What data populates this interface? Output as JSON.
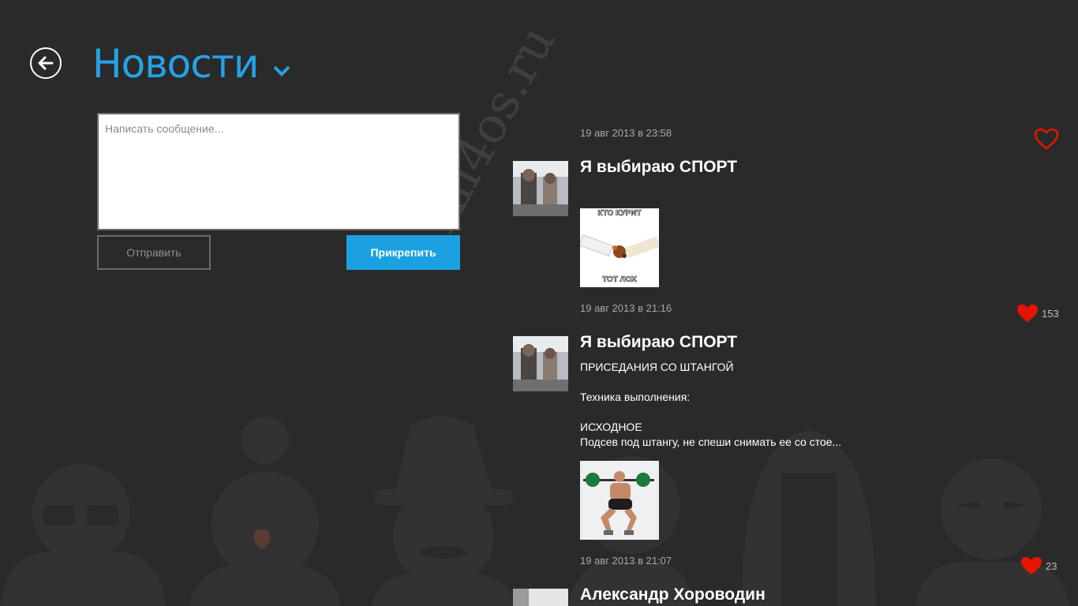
{
  "header": {
    "title": "Новости",
    "back_icon": "back-arrow-icon",
    "dropdown_icon": "chevron-down-icon"
  },
  "composer": {
    "placeholder": "Написать сообщение...",
    "value": "",
    "send_label": "Отправить",
    "attach_label": "Прикрепить"
  },
  "watermark": "All4os.ru",
  "colors": {
    "accent": "#1ba1e2",
    "title": "#27a1e5",
    "like": "#e51400",
    "background": "#2a2a2a"
  },
  "posts": [
    {
      "date": "19 авг 2013 в 23:58",
      "author": "Я выбираю СПОРТ",
      "text": "",
      "image_caption_top": "КТО КУРИТ",
      "image_caption_bottom": "ТОТ ЛОХ",
      "liked": false,
      "likes": ""
    },
    {
      "date": "19 авг 2013 в 21:16",
      "author": "Я выбираю СПОРТ",
      "text": "ПРИСЕДАНИЯ СО ШТАНГОЙ\n\nТехника выполнения:\n\nИСХОДНОЕ\nПодсев под штангу, не спеши снимать ее со стое...",
      "liked": true,
      "likes": "153"
    },
    {
      "date": "19 авг 2013 в 21:07",
      "author": "Александр Хороводин",
      "text": "",
      "liked": true,
      "likes": "23"
    }
  ]
}
